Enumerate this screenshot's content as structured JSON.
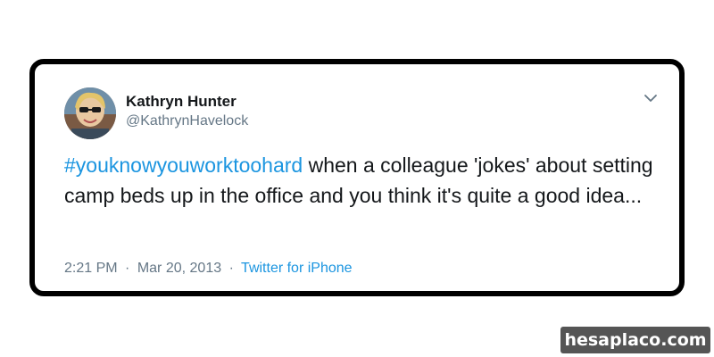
{
  "tweet": {
    "author_name": "Kathryn Hunter",
    "author_handle": "@KathrynHavelock",
    "hashtag": "#youknowyouworktoohard",
    "body_text": " when a colleague 'jokes' about setting camp beds up in the office and you think it's quite a good idea...",
    "time": "2:21 PM",
    "separator": "·",
    "date": "Mar 20, 2013",
    "source": "Twitter for iPhone",
    "menu_icon": "chevron-down-icon",
    "avatar_icon": "avatar"
  },
  "watermark": {
    "text": "hesaplaco.com"
  },
  "colors": {
    "link": "#1b95e0",
    "secondary_text": "#657786",
    "primary_text": "#14171a",
    "card_border": "#000000",
    "watermark_bg": "#555555"
  }
}
